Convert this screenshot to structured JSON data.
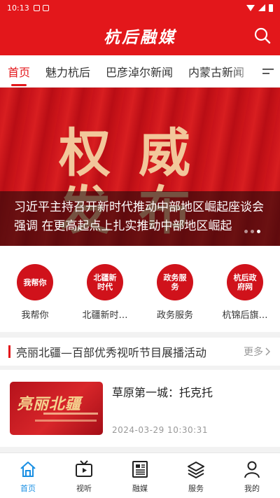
{
  "status_bar": {
    "time": "10:13"
  },
  "header": {
    "title": "杭后融媒",
    "icon": "search-icon"
  },
  "tabs": [
    {
      "label": "首页"
    },
    {
      "label": "魅力杭后"
    },
    {
      "label": "巴彦淖尔新闻"
    },
    {
      "label": "内蒙古新闻"
    }
  ],
  "active_tab": "首页",
  "banner": {
    "line1": "权威",
    "line2": "发布",
    "caption": "习近平主持召开新时代推动中部地区崛起座谈会强调 在更高起点上扎实推动中部地区崛起",
    "slides": 3,
    "active_slide": 3
  },
  "quick_links": [
    {
      "circle_text": "我帮你",
      "label": "我帮你"
    },
    {
      "circle_text": "北疆新时代",
      "label": "北疆新时…"
    },
    {
      "circle_text": "政务服务",
      "label": "政务服务"
    },
    {
      "circle_text": "杭后政府网",
      "label": "杭锦后旗…"
    }
  ],
  "section": {
    "title": "亮丽北疆—百部优秀视听节目展播活动",
    "more": "更多"
  },
  "news": [
    {
      "title": "草原第一城：托克托",
      "date": "2024-03-29  10:30:31",
      "thumb_text": "亮丽北疆"
    }
  ],
  "bottom_nav": [
    {
      "label": "首页",
      "icon": "home-icon"
    },
    {
      "label": "视听",
      "icon": "tv-icon"
    },
    {
      "label": "融媒",
      "icon": "newspaper-icon"
    },
    {
      "label": "服务",
      "icon": "layers-icon"
    },
    {
      "label": "我的",
      "icon": "user-icon"
    }
  ],
  "colors": {
    "brand_red": "#e3171b",
    "active_nav": "#1a8fe3"
  }
}
